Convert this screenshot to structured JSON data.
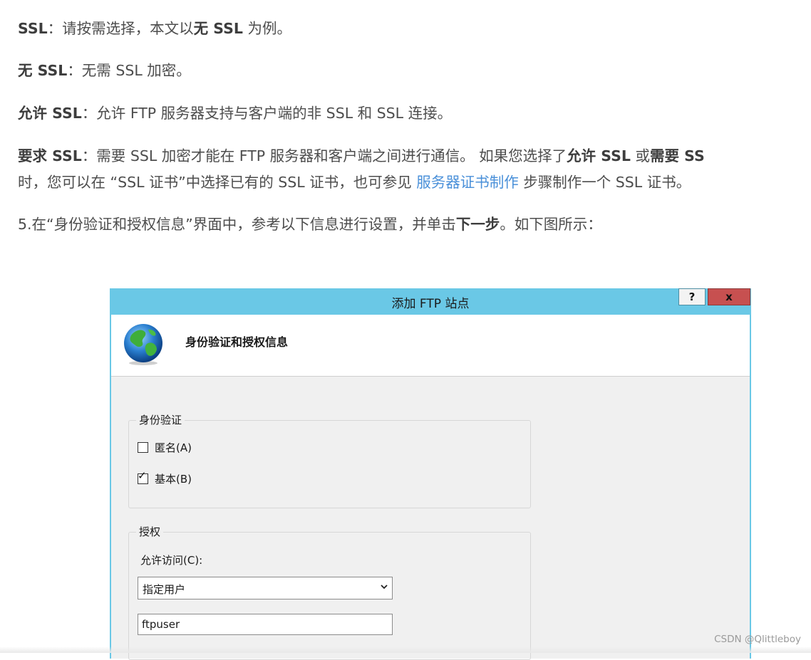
{
  "paragraphs": {
    "p1": {
      "b1": "SSL",
      "t1": "：请按需选择，本文以",
      "b2": "无 SSL",
      "t2": " 为例。"
    },
    "p2": {
      "b1": "无 SSL",
      "t1": "：无需 SSL 加密。"
    },
    "p3": {
      "b1": "允许 SSL",
      "t1": "：允许 FTP 服务器支持与客户端的非 SSL 和 SSL 连接。"
    },
    "p4": {
      "b1": "要求 SSL",
      "t1": "：需要 SSL 加密才能在 FTP 服务器和客户端之间进行通信。 如果您选择了",
      "b2": "允许 SSL",
      "t2": " 或",
      "b3": "需要 SS",
      "l2_t1": "时，您可以在 “SSL 证书”中选择已有的 SSL 证书，也可参见 ",
      "link": "服务器证书制作",
      "l2_t2": " 步骤制作一个 SSL 证书。"
    },
    "p5": {
      "t1": "5.在“身份验证和授权信息”界面中，参考以下信息进行设置，并单击",
      "b1": "下一步",
      "t2": "。如下图所示："
    }
  },
  "dialog": {
    "title": "添加 FTP 站点",
    "help_label": "?",
    "close_label": "x",
    "header_title": "身份验证和授权信息",
    "auth_group": {
      "legend": "身份验证",
      "anonymous": {
        "label": "匿名(A)",
        "checked": false
      },
      "basic": {
        "label": "基本(B)",
        "checked": true,
        "mark": "✓"
      }
    },
    "authz_group": {
      "legend": "授权",
      "allow_access_label": "允许访问(C):",
      "allow_access_value": "指定用户",
      "user_value": "ftpuser"
    }
  },
  "watermark": "CSDN @Qlittleboy",
  "colors": {
    "titlebar": "#6ac8e6",
    "close": "#c75050",
    "link": "#4a90d9"
  }
}
